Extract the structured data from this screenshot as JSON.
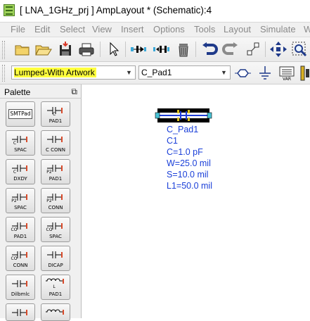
{
  "window": {
    "title": "[ LNA_1GHz_prj ] AmpLayout * (Schematic):4"
  },
  "menu": [
    "File",
    "Edit",
    "Select",
    "View",
    "Insert",
    "Options",
    "Tools",
    "Layout",
    "Simulate",
    "W"
  ],
  "toolbar": {
    "icons": [
      "open-folder-icon",
      "open-file-icon",
      "save-icon",
      "print-icon",
      "select-arrow-icon",
      "mirror-x-icon",
      "mirror-y-icon",
      "delete-icon",
      "undo-icon",
      "redo-icon",
      "probe-icon",
      "move-icon",
      "zoom-icon"
    ]
  },
  "toolbar2": {
    "library_selected": "Lumped-With Artwork",
    "component_selected": "C_Pad1",
    "var_label": "VAR"
  },
  "palette": {
    "title": "Palette",
    "items": [
      {
        "label": "SMTPad",
        "symbol": "box"
      },
      {
        "label": "PAD1",
        "symbol": "C"
      },
      {
        "label": "SPAC",
        "symbol": "C"
      },
      {
        "label": "C CONN",
        "symbol": "C"
      },
      {
        "label": "DXDY",
        "symbol": "C"
      },
      {
        "label": "PAD1",
        "symbol": "P2"
      },
      {
        "label": "SPAC",
        "symbol": "P2"
      },
      {
        "label": "CONN",
        "symbol": "P2"
      },
      {
        "label": "PAD1",
        "symbol": "CQ"
      },
      {
        "label": "SPAC",
        "symbol": "CQ"
      },
      {
        "label": "CONN",
        "symbol": "CQ"
      },
      {
        "label": "DICAP",
        "symbol": "C"
      },
      {
        "label": "Dilbmlc",
        "symbol": "C"
      },
      {
        "label": "PAD1",
        "symbol": "L"
      },
      {
        "label": "",
        "symbol": "C"
      },
      {
        "label": "",
        "symbol": "L"
      }
    ]
  },
  "component": {
    "name": "C_Pad1",
    "instance": "C1",
    "params": [
      "C=1.0 pF",
      "W=25.0 mil",
      "S=10.0 mil",
      "L1=50.0 mil"
    ]
  },
  "colors": {
    "highlight": "#ffff3c",
    "param_text": "#1a3fd8",
    "pin": "#49c3d6"
  }
}
